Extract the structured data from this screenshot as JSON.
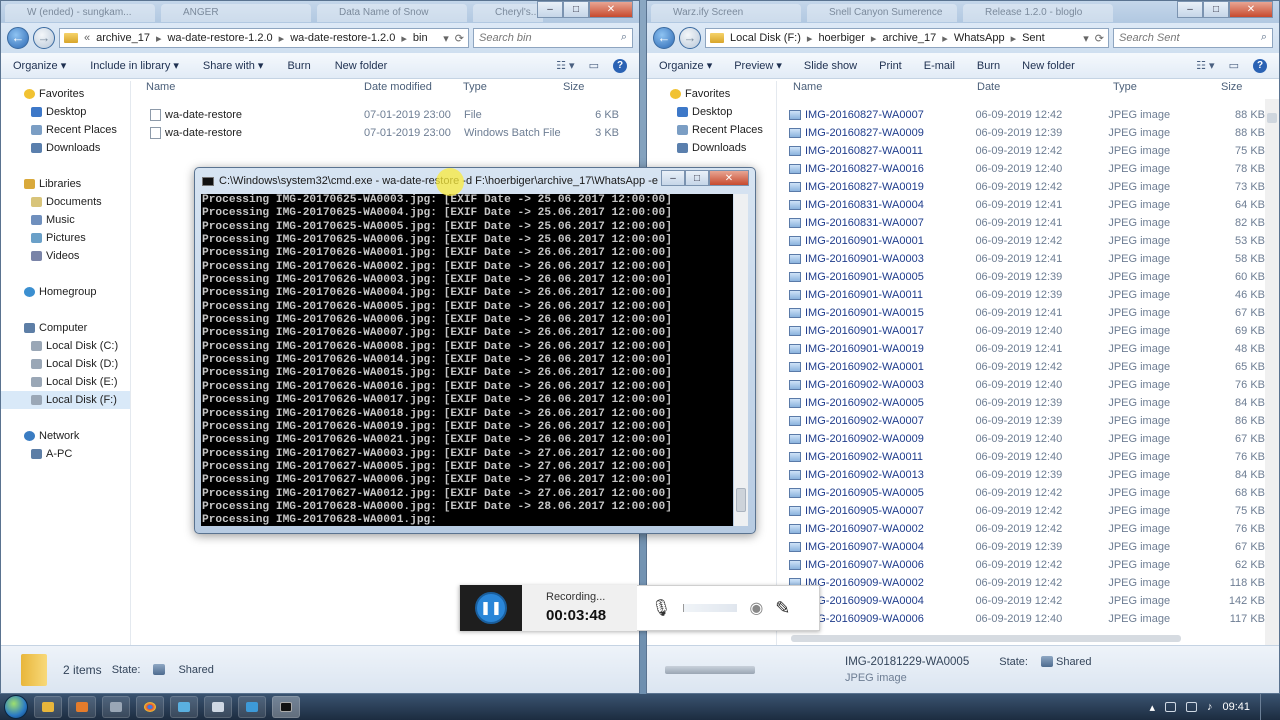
{
  "left": {
    "tabs": [
      "W (ended) - sungkam...",
      "ANGER",
      "Data Name of Snow",
      "Cheryl's..."
    ],
    "address": [
      "archive_17",
      "wa-date-restore-1.2.0",
      "wa-date-restore-1.2.0",
      "bin"
    ],
    "search_placeholder": "Search bin",
    "toolbar": [
      "Organize ▾",
      "Include in library ▾",
      "Share with ▾",
      "Burn",
      "New folder"
    ],
    "nav": {
      "favorites": "Favorites",
      "desktop": "Desktop",
      "recent": "Recent Places",
      "downloads": "Downloads",
      "libraries": "Libraries",
      "documents": "Documents",
      "music": "Music",
      "pictures": "Pictures",
      "videos": "Videos",
      "homegroup": "Homegroup",
      "computer": "Computer",
      "disk_c": "Local Disk (C:)",
      "disk_d": "Local Disk (D:)",
      "disk_e": "Local Disk (E:)",
      "disk_f": "Local Disk (F:)",
      "network": "Network",
      "apc": "A-PC"
    },
    "columns": {
      "name": "Name",
      "date": "Date modified",
      "type": "Type",
      "size": "Size"
    },
    "files": [
      {
        "name": "wa-date-restore",
        "date": "07-01-2019 23:00",
        "type": "File",
        "size": "6 KB"
      },
      {
        "name": "wa-date-restore",
        "date": "07-01-2019 23:00",
        "type": "Windows Batch File",
        "size": "3 KB"
      }
    ],
    "status": {
      "count": "2 items",
      "state_label": "State:",
      "state": "Shared"
    }
  },
  "right": {
    "tabs": [
      "Warz.ify Screen",
      "Snell Canyon Sumerence",
      "Release 1.2.0 - bloglo"
    ],
    "address": [
      "Local Disk (F:)",
      "hoerbiger",
      "archive_17",
      "WhatsApp",
      "Sent"
    ],
    "search_placeholder": "Search Sent",
    "toolbar": [
      "Organize ▾",
      "Preview ▾",
      "Slide show",
      "Print",
      "E-mail",
      "Burn",
      "New folder"
    ],
    "nav": {
      "favorites": "Favorites",
      "desktop": "Desktop",
      "recent": "Recent Places",
      "downloads": "Downloads"
    },
    "columns": {
      "name": "Name",
      "date": "Date",
      "type": "Type",
      "size": "Size"
    },
    "files": [
      {
        "name": "IMG-20160827-WA0007",
        "date": "06-09-2019 12:42",
        "type": "JPEG image",
        "size": "88 KB"
      },
      {
        "name": "IMG-20160827-WA0009",
        "date": "06-09-2019 12:39",
        "type": "JPEG image",
        "size": "88 KB"
      },
      {
        "name": "IMG-20160827-WA0011",
        "date": "06-09-2019 12:42",
        "type": "JPEG image",
        "size": "75 KB"
      },
      {
        "name": "IMG-20160827-WA0016",
        "date": "06-09-2019 12:40",
        "type": "JPEG image",
        "size": "78 KB"
      },
      {
        "name": "IMG-20160827-WA0019",
        "date": "06-09-2019 12:42",
        "type": "JPEG image",
        "size": "73 KB"
      },
      {
        "name": "IMG-20160831-WA0004",
        "date": "06-09-2019 12:41",
        "type": "JPEG image",
        "size": "64 KB"
      },
      {
        "name": "IMG-20160831-WA0007",
        "date": "06-09-2019 12:41",
        "type": "JPEG image",
        "size": "82 KB"
      },
      {
        "name": "IMG-20160901-WA0001",
        "date": "06-09-2019 12:42",
        "type": "JPEG image",
        "size": "53 KB"
      },
      {
        "name": "IMG-20160901-WA0003",
        "date": "06-09-2019 12:41",
        "type": "JPEG image",
        "size": "58 KB"
      },
      {
        "name": "IMG-20160901-WA0005",
        "date": "06-09-2019 12:39",
        "type": "JPEG image",
        "size": "60 KB"
      },
      {
        "name": "IMG-20160901-WA0011",
        "date": "06-09-2019 12:39",
        "type": "JPEG image",
        "size": "46 KB"
      },
      {
        "name": "IMG-20160901-WA0015",
        "date": "06-09-2019 12:41",
        "type": "JPEG image",
        "size": "67 KB"
      },
      {
        "name": "IMG-20160901-WA0017",
        "date": "06-09-2019 12:40",
        "type": "JPEG image",
        "size": "69 KB"
      },
      {
        "name": "IMG-20160901-WA0019",
        "date": "06-09-2019 12:41",
        "type": "JPEG image",
        "size": "48 KB"
      },
      {
        "name": "IMG-20160902-WA0001",
        "date": "06-09-2019 12:42",
        "type": "JPEG image",
        "size": "65 KB"
      },
      {
        "name": "IMG-20160902-WA0003",
        "date": "06-09-2019 12:40",
        "type": "JPEG image",
        "size": "76 KB"
      },
      {
        "name": "IMG-20160902-WA0005",
        "date": "06-09-2019 12:39",
        "type": "JPEG image",
        "size": "84 KB"
      },
      {
        "name": "IMG-20160902-WA0007",
        "date": "06-09-2019 12:39",
        "type": "JPEG image",
        "size": "86 KB"
      },
      {
        "name": "IMG-20160902-WA0009",
        "date": "06-09-2019 12:40",
        "type": "JPEG image",
        "size": "67 KB"
      },
      {
        "name": "IMG-20160902-WA0011",
        "date": "06-09-2019 12:40",
        "type": "JPEG image",
        "size": "76 KB"
      },
      {
        "name": "IMG-20160902-WA0013",
        "date": "06-09-2019 12:39",
        "type": "JPEG image",
        "size": "84 KB"
      },
      {
        "name": "IMG-20160905-WA0005",
        "date": "06-09-2019 12:42",
        "type": "JPEG image",
        "size": "68 KB"
      },
      {
        "name": "IMG-20160905-WA0007",
        "date": "06-09-2019 12:42",
        "type": "JPEG image",
        "size": "75 KB"
      },
      {
        "name": "IMG-20160907-WA0002",
        "date": "06-09-2019 12:42",
        "type": "JPEG image",
        "size": "76 KB"
      },
      {
        "name": "IMG-20160907-WA0004",
        "date": "06-09-2019 12:39",
        "type": "JPEG image",
        "size": "67 KB"
      },
      {
        "name": "IMG-20160907-WA0006",
        "date": "06-09-2019 12:42",
        "type": "JPEG image",
        "size": "62 KB"
      },
      {
        "name": "IMG-20160909-WA0002",
        "date": "06-09-2019 12:42",
        "type": "JPEG image",
        "size": "118 KB"
      },
      {
        "name": "IMG-20160909-WA0004",
        "date": "06-09-2019 12:42",
        "type": "JPEG image",
        "size": "142 KB"
      },
      {
        "name": "IMG-20160909-WA0006",
        "date": "06-09-2019 12:40",
        "type": "JPEG image",
        "size": "117 KB"
      }
    ],
    "status": {
      "name": "IMG-20181229-WA0005",
      "state_label": "State:",
      "state": "Shared",
      "type": "JPEG image"
    }
  },
  "cmd": {
    "title": "C:\\Windows\\system32\\cmd.exe - wa-date-restore -d F:\\hoerbiger\\archive_17\\WhatsApp -e",
    "lines": [
      "Processing IMG-20170625-WA0003.jpg: [EXIF Date -> 25.06.2017 12:00:00]",
      "Processing IMG-20170625-WA0004.jpg: [EXIF Date -> 25.06.2017 12:00:00]",
      "Processing IMG-20170625-WA0005.jpg: [EXIF Date -> 25.06.2017 12:00:00]",
      "Processing IMG-20170625-WA0006.jpg: [EXIF Date -> 25.06.2017 12:00:00]",
      "Processing IMG-20170626-WA0001.jpg: [EXIF Date -> 26.06.2017 12:00:00]",
      "Processing IMG-20170626-WA0002.jpg: [EXIF Date -> 26.06.2017 12:00:00]",
      "Processing IMG-20170626-WA0003.jpg: [EXIF Date -> 26.06.2017 12:00:00]",
      "Processing IMG-20170626-WA0004.jpg: [EXIF Date -> 26.06.2017 12:00:00]",
      "Processing IMG-20170626-WA0005.jpg: [EXIF Date -> 26.06.2017 12:00:00]",
      "Processing IMG-20170626-WA0006.jpg: [EXIF Date -> 26.06.2017 12:00:00]",
      "Processing IMG-20170626-WA0007.jpg: [EXIF Date -> 26.06.2017 12:00:00]",
      "Processing IMG-20170626-WA0008.jpg: [EXIF Date -> 26.06.2017 12:00:00]",
      "Processing IMG-20170626-WA0014.jpg: [EXIF Date -> 26.06.2017 12:00:00]",
      "Processing IMG-20170626-WA0015.jpg: [EXIF Date -> 26.06.2017 12:00:00]",
      "Processing IMG-20170626-WA0016.jpg: [EXIF Date -> 26.06.2017 12:00:00]",
      "Processing IMG-20170626-WA0017.jpg: [EXIF Date -> 26.06.2017 12:00:00]",
      "Processing IMG-20170626-WA0018.jpg: [EXIF Date -> 26.06.2017 12:00:00]",
      "Processing IMG-20170626-WA0019.jpg: [EXIF Date -> 26.06.2017 12:00:00]",
      "Processing IMG-20170626-WA0021.jpg: [EXIF Date -> 26.06.2017 12:00:00]",
      "Processing IMG-20170627-WA0003.jpg: [EXIF Date -> 27.06.2017 12:00:00]",
      "Processing IMG-20170627-WA0005.jpg: [EXIF Date -> 27.06.2017 12:00:00]",
      "Processing IMG-20170627-WA0006.jpg: [EXIF Date -> 27.06.2017 12:00:00]",
      "Processing IMG-20170627-WA0012.jpg: [EXIF Date -> 27.06.2017 12:00:00]",
      "Processing IMG-20170628-WA0000.jpg: [EXIF Date -> 28.06.2017 12:00:00]",
      "Processing IMG-20170628-WA0001.jpg:"
    ]
  },
  "recorder": {
    "status": "Recording...",
    "time": "00:03:48"
  },
  "taskbar": {
    "clock": "09:41"
  },
  "colors": {
    "link": "#1e3c8c",
    "accent": "#2a86d8",
    "selection": "#d9e9f8"
  }
}
